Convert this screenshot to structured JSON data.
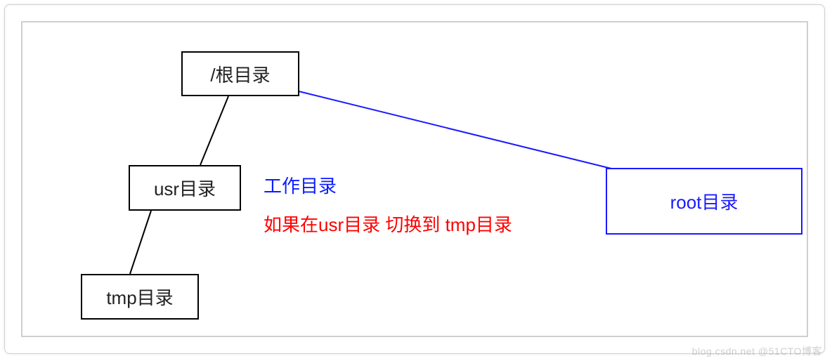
{
  "diagram": {
    "nodes": {
      "root": "/根目录",
      "usr": "usr目录",
      "tmp": "tmp目录",
      "root_dir": "root目录"
    },
    "labels": {
      "working_dir": "工作目录",
      "instruction": "如果在usr目录 切换到 tmp目录"
    }
  },
  "watermark": "blog.csdn.net @51CTO博客"
}
